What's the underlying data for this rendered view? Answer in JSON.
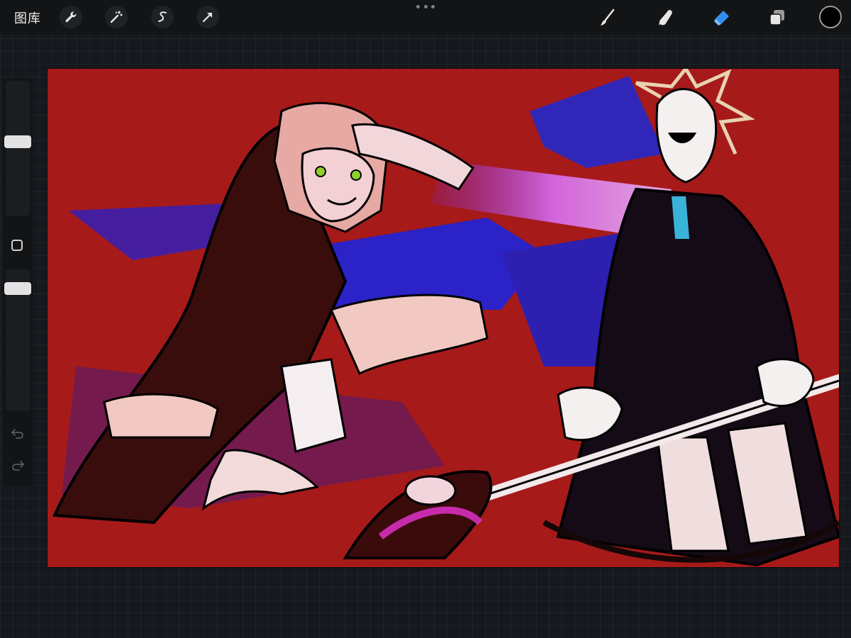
{
  "toolbar": {
    "gallery_label": "图库",
    "left_tools": [
      {
        "name": "actions",
        "icon": "wrench-icon"
      },
      {
        "name": "adjustments",
        "icon": "magic-wand-icon"
      },
      {
        "name": "selection",
        "icon": "selection-s-icon"
      },
      {
        "name": "transform",
        "icon": "arrow-cursor-icon"
      }
    ],
    "right_tools": [
      {
        "name": "brush",
        "icon": "brush-icon",
        "active": false
      },
      {
        "name": "smudge",
        "icon": "smudge-finger-icon",
        "active": false
      },
      {
        "name": "eraser",
        "icon": "eraser-icon",
        "active": true
      },
      {
        "name": "layers",
        "icon": "layers-icon",
        "active": false
      }
    ],
    "current_color": "#000000",
    "active_tool_color": "#2f8ff0"
  },
  "sidebar": {
    "brush_size_level": 0.55,
    "opacity_level": 0.9,
    "modify_icon": "square-outline-icon",
    "undo_icon": "undo-icon",
    "redo_icon": "redo-icon"
  },
  "canvas": {
    "background_color": "#a61a1a",
    "content": "artwork-illustration"
  }
}
